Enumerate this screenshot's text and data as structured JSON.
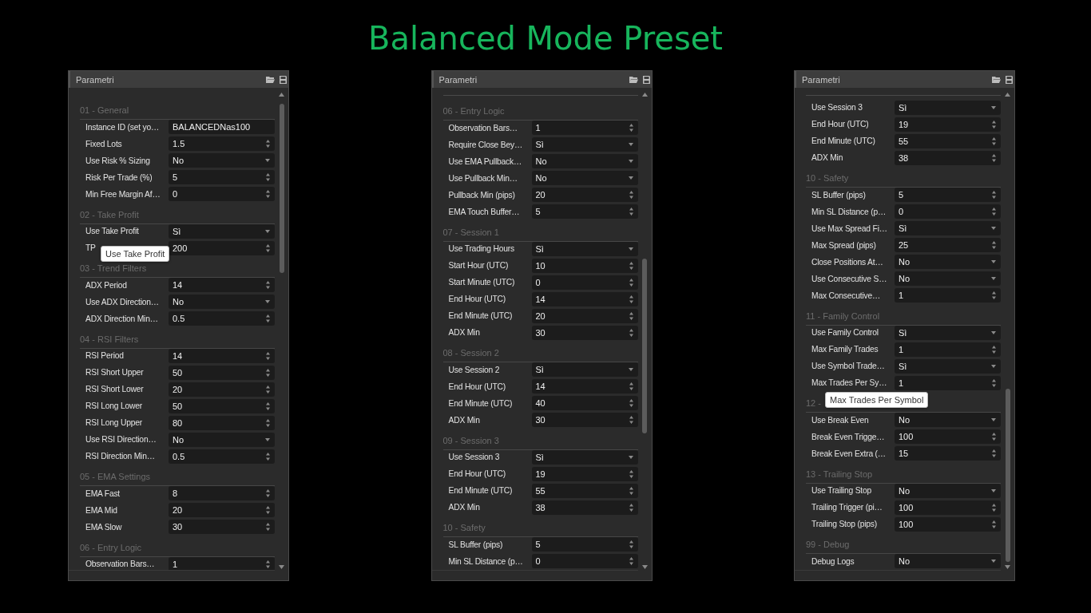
{
  "title": "Balanced Mode Preset",
  "panels": [
    {
      "title": "Parametri",
      "scrolled": false,
      "items": [
        {
          "kind": "section",
          "title": "01 - General"
        },
        {
          "kind": "text",
          "label": "Instance ID (set yo…",
          "value": "BALANCEDNas100"
        },
        {
          "kind": "number",
          "label": "Fixed Lots",
          "value": "1.5"
        },
        {
          "kind": "select",
          "label": "Use Risk % Sizing",
          "value": "No"
        },
        {
          "kind": "number",
          "label": "Risk Per Trade (%)",
          "value": "5"
        },
        {
          "kind": "number",
          "label": "Min Free Margin Af…",
          "value": "0"
        },
        {
          "kind": "section",
          "title": "02 - Take Profit"
        },
        {
          "kind": "select",
          "label": "Use Take Profit",
          "value": "Sì"
        },
        {
          "kind": "number",
          "label": "TP",
          "value": "200",
          "tooltip": "Use Take Profit"
        },
        {
          "kind": "section",
          "title": "03 - Trend Filters"
        },
        {
          "kind": "number",
          "label": "ADX Period",
          "value": "14"
        },
        {
          "kind": "select",
          "label": "Use ADX Direction…",
          "value": "No"
        },
        {
          "kind": "number",
          "label": "ADX Direction Min…",
          "value": "0.5"
        },
        {
          "kind": "section",
          "title": "04 - RSI Filters"
        },
        {
          "kind": "number",
          "label": "RSI Period",
          "value": "14"
        },
        {
          "kind": "number",
          "label": "RSI Short Upper",
          "value": "50"
        },
        {
          "kind": "number",
          "label": "RSI Short Lower",
          "value": "20"
        },
        {
          "kind": "number",
          "label": "RSI Long Lower",
          "value": "50"
        },
        {
          "kind": "number",
          "label": "RSI Long Upper",
          "value": "80"
        },
        {
          "kind": "select",
          "label": "Use RSI Direction…",
          "value": "No"
        },
        {
          "kind": "number",
          "label": "RSI Direction Min…",
          "value": "0.5"
        },
        {
          "kind": "section",
          "title": "05 - EMA Settings"
        },
        {
          "kind": "number",
          "label": "EMA Fast",
          "value": "8"
        },
        {
          "kind": "number",
          "label": "EMA Mid",
          "value": "20"
        },
        {
          "kind": "number",
          "label": "EMA Slow",
          "value": "30"
        },
        {
          "kind": "section",
          "title": "06 - Entry Logic"
        },
        {
          "kind": "number",
          "label": "Observation Bars…",
          "value": "1"
        }
      ]
    },
    {
      "title": "Parametri",
      "scrolled": true,
      "items": [
        {
          "kind": "section",
          "title": "06 - Entry Logic"
        },
        {
          "kind": "number",
          "label": "Observation Bars…",
          "value": "1"
        },
        {
          "kind": "select",
          "label": "Require Close Bey…",
          "value": "Sì"
        },
        {
          "kind": "select",
          "label": "Use EMA Pullback…",
          "value": "No"
        },
        {
          "kind": "select",
          "label": "Use Pullback Min…",
          "value": "No"
        },
        {
          "kind": "number",
          "label": "Pullback Min (pips)",
          "value": "20"
        },
        {
          "kind": "number",
          "label": "EMA Touch Buffer…",
          "value": "5"
        },
        {
          "kind": "section",
          "title": "07 - Session 1"
        },
        {
          "kind": "select",
          "label": "Use Trading Hours",
          "value": "Sì"
        },
        {
          "kind": "number",
          "label": "Start Hour (UTC)",
          "value": "10"
        },
        {
          "kind": "number",
          "label": "Start Minute (UTC)",
          "value": "0"
        },
        {
          "kind": "number",
          "label": "End Hour (UTC)",
          "value": "14"
        },
        {
          "kind": "number",
          "label": "End Minute (UTC)",
          "value": "20"
        },
        {
          "kind": "number",
          "label": "ADX Min",
          "value": "30"
        },
        {
          "kind": "section",
          "title": "08 - Session 2"
        },
        {
          "kind": "select",
          "label": "Use Session 2",
          "value": "Sì"
        },
        {
          "kind": "number",
          "label": "End Hour (UTC)",
          "value": "14"
        },
        {
          "kind": "number",
          "label": "End Minute (UTC)",
          "value": "40"
        },
        {
          "kind": "number",
          "label": "ADX Min",
          "value": "30"
        },
        {
          "kind": "section",
          "title": "09 - Session 3"
        },
        {
          "kind": "select",
          "label": "Use Session 3",
          "value": "Sì"
        },
        {
          "kind": "number",
          "label": "End Hour (UTC)",
          "value": "19"
        },
        {
          "kind": "number",
          "label": "End Minute (UTC)",
          "value": "55"
        },
        {
          "kind": "number",
          "label": "ADX Min",
          "value": "38"
        },
        {
          "kind": "section",
          "title": "10 - Safety"
        },
        {
          "kind": "number",
          "label": "SL Buffer (pips)",
          "value": "5"
        },
        {
          "kind": "number",
          "label": "Min SL Distance (p…",
          "value": "0"
        }
      ]
    },
    {
      "title": "Parametri",
      "scrolled": true,
      "items": [
        {
          "kind": "select",
          "label": "Use Session 3",
          "value": "Sì"
        },
        {
          "kind": "number",
          "label": "End Hour (UTC)",
          "value": "19"
        },
        {
          "kind": "number",
          "label": "End Minute (UTC)",
          "value": "55"
        },
        {
          "kind": "number",
          "label": "ADX Min",
          "value": "38"
        },
        {
          "kind": "section",
          "title": "10 - Safety"
        },
        {
          "kind": "number",
          "label": "SL Buffer (pips)",
          "value": "5"
        },
        {
          "kind": "number",
          "label": "Min SL Distance (p…",
          "value": "0"
        },
        {
          "kind": "select",
          "label": "Use Max Spread Fi…",
          "value": "Sì"
        },
        {
          "kind": "number",
          "label": "Max Spread (pips)",
          "value": "25"
        },
        {
          "kind": "select",
          "label": "Close Positions At…",
          "value": "No"
        },
        {
          "kind": "select",
          "label": "Use Consecutive S…",
          "value": "No"
        },
        {
          "kind": "number",
          "label": "Max Consecutive…",
          "value": "1"
        },
        {
          "kind": "section",
          "title": "11 - Family Control"
        },
        {
          "kind": "select",
          "label": "Use Family Control",
          "value": "Sì"
        },
        {
          "kind": "number",
          "label": "Max Family Trades",
          "value": "1"
        },
        {
          "kind": "select",
          "label": "Use Symbol Trade…",
          "value": "Sì"
        },
        {
          "kind": "number",
          "label": "Max Trades Per Sy…",
          "value": "1"
        },
        {
          "kind": "section",
          "title": "12 -",
          "tooltip": "Max Trades Per Symbol"
        },
        {
          "kind": "select",
          "label": "Use Break Even",
          "value": "No"
        },
        {
          "kind": "number",
          "label": "Break Even Trigge…",
          "value": "100"
        },
        {
          "kind": "number",
          "label": "Break Even Extra (…",
          "value": "15"
        },
        {
          "kind": "section",
          "title": "13 - Trailing Stop"
        },
        {
          "kind": "select",
          "label": "Use Trailing Stop",
          "value": "No"
        },
        {
          "kind": "number",
          "label": "Trailing Trigger (pi…",
          "value": "100"
        },
        {
          "kind": "number",
          "label": "Trailing Stop (pips)",
          "value": "100"
        },
        {
          "kind": "section",
          "title": "99 - Debug"
        },
        {
          "kind": "select",
          "label": "Debug Logs",
          "value": "No"
        }
      ]
    }
  ]
}
